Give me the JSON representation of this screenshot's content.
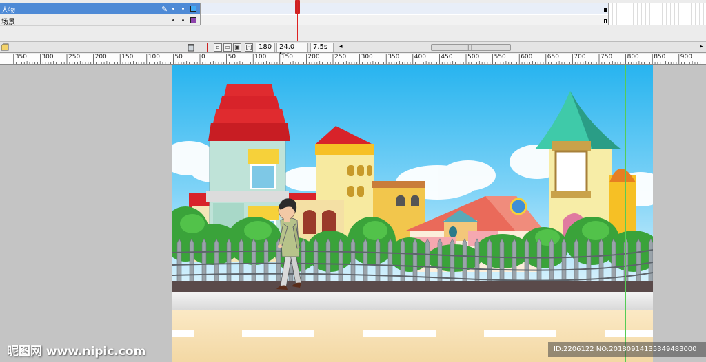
{
  "timeline": {
    "layers": [
      {
        "name": "人物",
        "selected": true,
        "color": "#3fa9f5"
      },
      {
        "name": "场景",
        "selected": false,
        "color": "#8e44ad"
      }
    ],
    "current_frame": "180",
    "frame_rate": "24.0 fps",
    "elapsed_time": "7.5s",
    "toolbar_icons": [
      "new-layer-icon",
      "delete-layer-icon",
      "onion-skin-icon",
      "onion-skin-outline-icon",
      "edit-multiple-frames-icon",
      "modify-onion-markers-icon",
      "center-frame-icon"
    ]
  },
  "ruler": {
    "labels": [
      "350",
      "300",
      "250",
      "200",
      "150",
      "100",
      "50",
      "0",
      "50",
      "100",
      "150",
      "200",
      "250",
      "300",
      "350",
      "400",
      "450",
      "500",
      "550",
      "600",
      "650",
      "700",
      "750",
      "800",
      "850",
      "900"
    ]
  },
  "watermark": {
    "left": "昵图网 www.nipic.com",
    "right": "ID:2206122 NO:20180914135349483000"
  },
  "colors": {
    "sky_top": "#29b6f0",
    "sky_bottom": "#cdeefc",
    "roof_red": "#d8232a",
    "roof_teal": "#3cc9a8",
    "bush_green": "#3aa33a",
    "fence": "#9aa3aa",
    "road": "#f5deb0"
  }
}
